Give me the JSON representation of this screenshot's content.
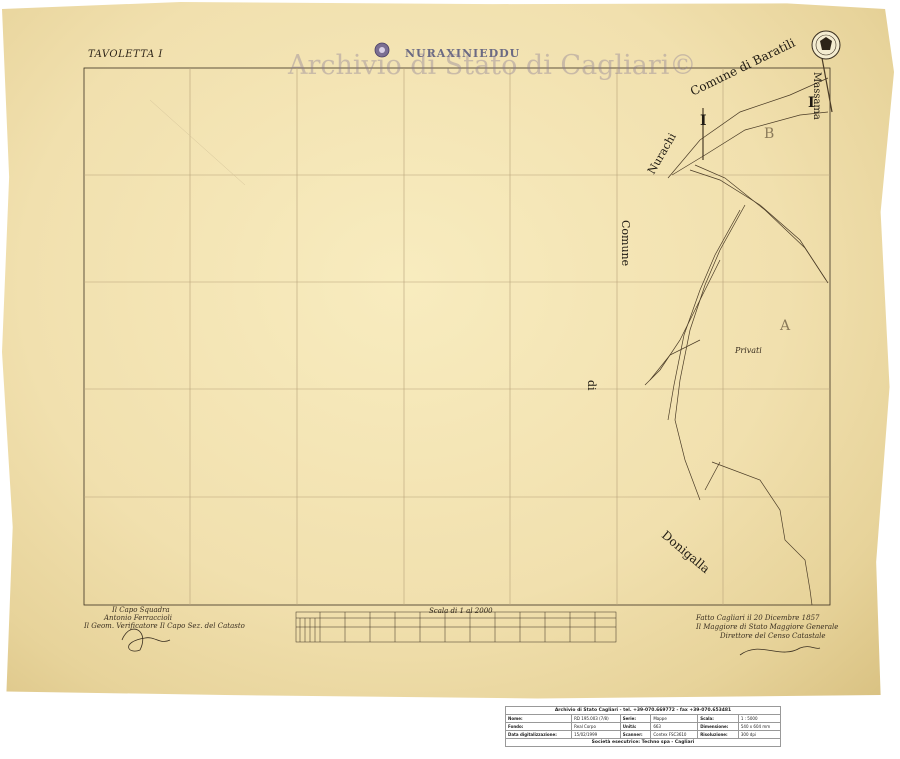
{
  "sheet": {
    "tile_label": "TAVOLETTA I",
    "title": "NURAXINIEDDU",
    "watermark": "Archivio di Stato di Cagliari©",
    "scale_label": "Scala di 1 al 2000",
    "colors": {
      "paper": "#f1e0ae",
      "ink": "#2d2418",
      "grid": "#b8a27a",
      "watermark": "#8778a0"
    }
  },
  "map_labels": {
    "comune_di_baratili": "Comune di Baratili",
    "nurachi": "Nurachi",
    "massama": "Massama",
    "comune_vertical": "Comune",
    "di": "di",
    "donigalla": "Donigalla",
    "privati": "Privati",
    "zone_I_left": "I",
    "zone_I_right": "I",
    "zone_B": "B",
    "zone_A": "A"
  },
  "signatures": {
    "left": [
      "Il Capo Squadra",
      "Antonio Ferraccioli",
      "Il Geom. Verificatore  Il Capo Sez. del Catasto"
    ],
    "right": [
      "Fatto Cagliari il 20 Dicembre 1857",
      "Il Maggiore di Stato Maggiore Generale",
      "Direttore del Censo Catastale"
    ]
  },
  "archive_info": {
    "header": "Archivio di Stato Cagliari - tel. +39-070.669772 - fax +39-070.653481",
    "rows": [
      [
        "Nome:",
        "RD 195.003 (7/8)",
        "Serie:",
        "Mappe",
        "Scala:",
        "1 : 5000"
      ],
      [
        "Fondo:",
        "Real Corpo",
        "Unità:",
        "663",
        "Dimensione:",
        "540 x 604 mm"
      ],
      [
        "Data digitalizzazione:",
        "15/02/1999",
        "Scanner:",
        "Contex FSC3610",
        "Risoluzione:",
        "300 dpi"
      ]
    ],
    "footer": "Società esecutrice: Techno spa - Cagliari"
  }
}
